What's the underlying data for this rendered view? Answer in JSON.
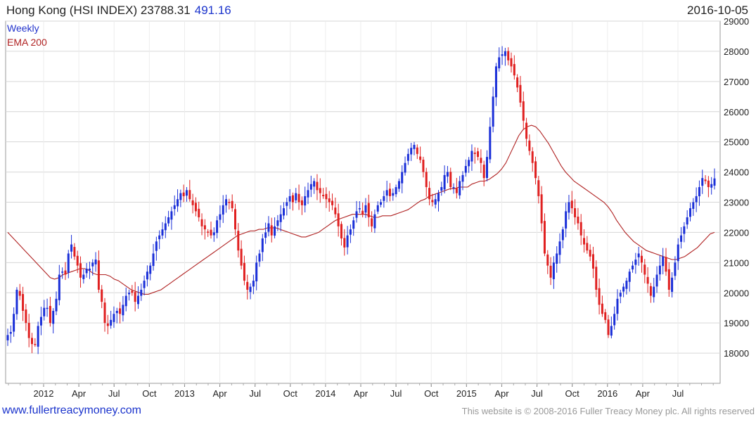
{
  "header": {
    "title": "Hong Kong (HSI INDEX) 23788.31",
    "change": "491.16",
    "date": "2016-10-05"
  },
  "legend": {
    "series1": "Weekly",
    "series2": "EMA 200"
  },
  "footer": {
    "left": "www.fullertreacymoney.com",
    "right": "This website is © 2008-2016 Fuller Treacy Money plc. All rights reserved"
  },
  "colors": {
    "up": "#1a2fd8",
    "down": "#e02020",
    "ema": "#b02222",
    "grid": "#d6d6d6"
  },
  "chart_data": {
    "type": "candlestick",
    "title": "Hong Kong (HSI INDEX) 23788.31 491.16",
    "ylim": [
      17000,
      29000
    ],
    "yticks": [
      18000,
      19000,
      20000,
      21000,
      22000,
      23000,
      24000,
      25000,
      26000,
      27000,
      28000,
      29000
    ],
    "xtick_labels": [
      "2012",
      "Apr",
      "Jul",
      "Oct",
      "2013",
      "Apr",
      "Jul",
      "Oct",
      "2014",
      "Apr",
      "Jul",
      "Oct",
      "2015",
      "Apr",
      "Jul",
      "Oct",
      "2016",
      "Apr",
      "Jul"
    ],
    "grid": true,
    "legend_position": "top-left",
    "series": [
      {
        "name": "Weekly",
        "style": "candles",
        "closes": [
          18600,
          18700,
          19300,
          20100,
          19900,
          19400,
          19000,
          18500,
          18300,
          18300,
          18900,
          19200,
          19500,
          19500,
          19000,
          19400,
          19800,
          20600,
          20700,
          20600,
          21300,
          21600,
          21200,
          20900,
          20500,
          20600,
          20800,
          20800,
          21000,
          21100,
          20100,
          19700,
          19000,
          18900,
          19100,
          19300,
          19400,
          19300,
          19600,
          19900,
          20000,
          20000,
          19700,
          19900,
          20100,
          20400,
          20700,
          20900,
          21300,
          21700,
          21900,
          22100,
          22300,
          22500,
          22700,
          22900,
          23100,
          23300,
          23200,
          23400,
          23100,
          22900,
          22700,
          22500,
          22200,
          22100,
          22000,
          21900,
          22000,
          22400,
          22600,
          22900,
          23100,
          23000,
          22800,
          22100,
          21400,
          20900,
          20400,
          20100,
          20200,
          20400,
          21000,
          21300,
          21800,
          22000,
          22300,
          21900,
          22200,
          22400,
          22600,
          22800,
          23000,
          23200,
          23000,
          23300,
          23000,
          22900,
          23200,
          23400,
          23600,
          23700,
          23400,
          23300,
          23200,
          23100,
          23000,
          22900,
          22600,
          22200,
          21800,
          21500,
          21900,
          22100,
          22400,
          22700,
          22800,
          22600,
          22900,
          22500,
          22200,
          22600,
          22900,
          23000,
          23200,
          23400,
          23200,
          23300,
          23500,
          23700,
          24000,
          24300,
          24600,
          24800,
          24900,
          24600,
          24400,
          24000,
          23500,
          23100,
          23000,
          23100,
          23300,
          23500,
          23900,
          24000,
          23500,
          23500,
          23300,
          23700,
          23900,
          24200,
          24400,
          24700,
          24600,
          24500,
          24300,
          23800,
          24500,
          25500,
          26500,
          27500,
          27800,
          27900,
          28000,
          27700,
          27500,
          27200,
          26800,
          26300,
          25700,
          25100,
          24700,
          24300,
          23800,
          23200,
          22300,
          21300,
          20900,
          20500,
          21000,
          21300,
          21700,
          22100,
          22700,
          23000,
          22800,
          22500,
          22300,
          21900,
          21600,
          21400,
          21200,
          20800,
          20100,
          19600,
          19300,
          19100,
          18600,
          18900,
          19300,
          19800,
          20000,
          20200,
          20400,
          20700,
          20900,
          21100,
          21300,
          21000,
          20600,
          20300,
          19900,
          20200,
          20600,
          20900,
          21200,
          20700,
          20100,
          20500,
          21000,
          21600,
          21900,
          22200,
          22500,
          22800,
          23000,
          23200,
          23500,
          23800,
          23700,
          23500,
          23600,
          23788
        ]
      },
      {
        "name": "EMA 200",
        "style": "line",
        "values": [
          22000,
          21850,
          21700,
          21550,
          21400,
          21250,
          21100,
          20950,
          20800,
          20650,
          20500,
          20450,
          20500,
          20600,
          20650,
          20700,
          20750,
          20800,
          20800,
          20750,
          20650,
          20600,
          20600,
          20600,
          20550,
          20450,
          20400,
          20300,
          20200,
          20100,
          20050,
          20000,
          19950,
          19950,
          20000,
          20050,
          20100,
          20200,
          20300,
          20400,
          20500,
          20600,
          20700,
          20800,
          20900,
          21000,
          21100,
          21200,
          21300,
          21400,
          21500,
          21600,
          21700,
          21800,
          21900,
          21950,
          22000,
          22050,
          22050,
          22100,
          22100,
          22150,
          22150,
          22150,
          22100,
          22050,
          22000,
          21950,
          21900,
          21850,
          21850,
          21900,
          21950,
          22000,
          22100,
          22200,
          22300,
          22400,
          22450,
          22500,
          22550,
          22600,
          22600,
          22600,
          22600,
          22550,
          22500,
          22500,
          22550,
          22550,
          22550,
          22600,
          22650,
          22700,
          22750,
          22850,
          22950,
          23050,
          23100,
          23200,
          23250,
          23300,
          23350,
          23400,
          23450,
          23450,
          23500,
          23500,
          23500,
          23600,
          23650,
          23700,
          23700,
          23750,
          23850,
          23950,
          24100,
          24300,
          24600,
          24900,
          25200,
          25400,
          25500,
          25550,
          25500,
          25350,
          25150,
          24950,
          24700,
          24450,
          24200,
          24000,
          23850,
          23700,
          23600,
          23500,
          23400,
          23300,
          23200,
          23100,
          23000,
          22850,
          22650,
          22400,
          22200,
          22000,
          21850,
          21700,
          21600,
          21500,
          21400,
          21350,
          21300,
          21250,
          21200,
          21150,
          21100,
          21100,
          21150,
          21200,
          21300,
          21400,
          21500,
          21650,
          21800,
          21950,
          22000
        ]
      }
    ]
  }
}
